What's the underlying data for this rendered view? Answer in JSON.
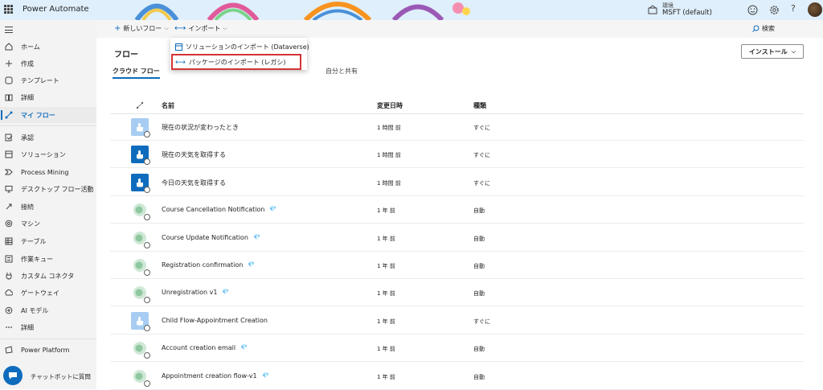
{
  "app": {
    "title": "Power Automate"
  },
  "environment": {
    "label": "環境",
    "value": "MSFT (default)"
  },
  "topbar": {
    "help": "?"
  },
  "sidebar": {
    "items": [
      {
        "label": "ホーム",
        "icon": "home-icon"
      },
      {
        "label": "作成",
        "icon": "plus-icon"
      },
      {
        "label": "テンプレート",
        "icon": "template-icon"
      },
      {
        "label": "詳細",
        "icon": "book-icon"
      },
      {
        "label": "マイ フロー",
        "icon": "flow-icon"
      },
      {
        "label": "承認",
        "icon": "approval-icon"
      },
      {
        "label": "ソリューション",
        "icon": "solution-icon"
      },
      {
        "label": "Process Mining",
        "icon": "process-mining-icon"
      },
      {
        "label": "デスクトップ フロー活動",
        "icon": "desktop-flow-icon"
      },
      {
        "label": "接続",
        "icon": "connection-icon"
      },
      {
        "label": "マシン",
        "icon": "machine-icon"
      },
      {
        "label": "テーブル",
        "icon": "table-icon"
      },
      {
        "label": "作業キュー",
        "icon": "work-queue-icon"
      },
      {
        "label": "カスタム コネクタ",
        "icon": "custom-connector-icon"
      },
      {
        "label": "ゲートウェイ",
        "icon": "gateway-icon"
      },
      {
        "label": "AI モデル",
        "icon": "ai-model-icon"
      },
      {
        "label": "詳細",
        "icon": "more-icon"
      },
      {
        "label": "Power Platform",
        "icon": "power-platform-icon"
      }
    ],
    "chatbot_label": "チャットボットに質問"
  },
  "commandbar": {
    "new_flow": "新しいフロー",
    "import": "インポート",
    "search": "検索"
  },
  "dropdown": {
    "items": [
      "ソリューションのインポート (Dataverse)",
      "パッケージのインポート (レガシ)"
    ]
  },
  "page": {
    "title": "フロー",
    "install": "インストール",
    "tabs": [
      "クラウド フロー",
      "自分と共有"
    ]
  },
  "table": {
    "columns": [
      "名前",
      "変更日時",
      "種類"
    ],
    "rows": [
      {
        "name": "現在の状況が変わったとき",
        "modified": "1 時間 前",
        "type": "すぐに",
        "icon": "light",
        "premium": false
      },
      {
        "name": "現在の天気を取得する",
        "modified": "1 時間 前",
        "type": "すぐに",
        "icon": "dark",
        "premium": false
      },
      {
        "name": "今日の天気を取得する",
        "modified": "1 時間 前",
        "type": "すぐに",
        "icon": "dark",
        "premium": false
      },
      {
        "name": "Course Cancellation Notification",
        "modified": "1 年 前",
        "type": "自動",
        "icon": "green",
        "premium": true
      },
      {
        "name": "Course Update Notification",
        "modified": "1 年 前",
        "type": "自動",
        "icon": "green",
        "premium": true
      },
      {
        "name": "Registration confirmation",
        "modified": "1 年 前",
        "type": "自動",
        "icon": "green",
        "premium": true
      },
      {
        "name": "Unregistration v1",
        "modified": "1 年 前",
        "type": "自動",
        "icon": "green",
        "premium": true
      },
      {
        "name": "Child Flow-Appointment Creation",
        "modified": "1 年 前",
        "type": "すぐに",
        "icon": "light",
        "premium": false
      },
      {
        "name": "Account creation email",
        "modified": "1 年 前",
        "type": "自動",
        "icon": "green",
        "premium": true
      },
      {
        "name": "Appointment creation flow-v1",
        "modified": "1 年 前",
        "type": "自動",
        "icon": "green",
        "premium": true
      }
    ]
  },
  "colors": {
    "accent": "#0f6cbd",
    "highlight": "#d13438",
    "sidebar": "#f3f3f3"
  }
}
